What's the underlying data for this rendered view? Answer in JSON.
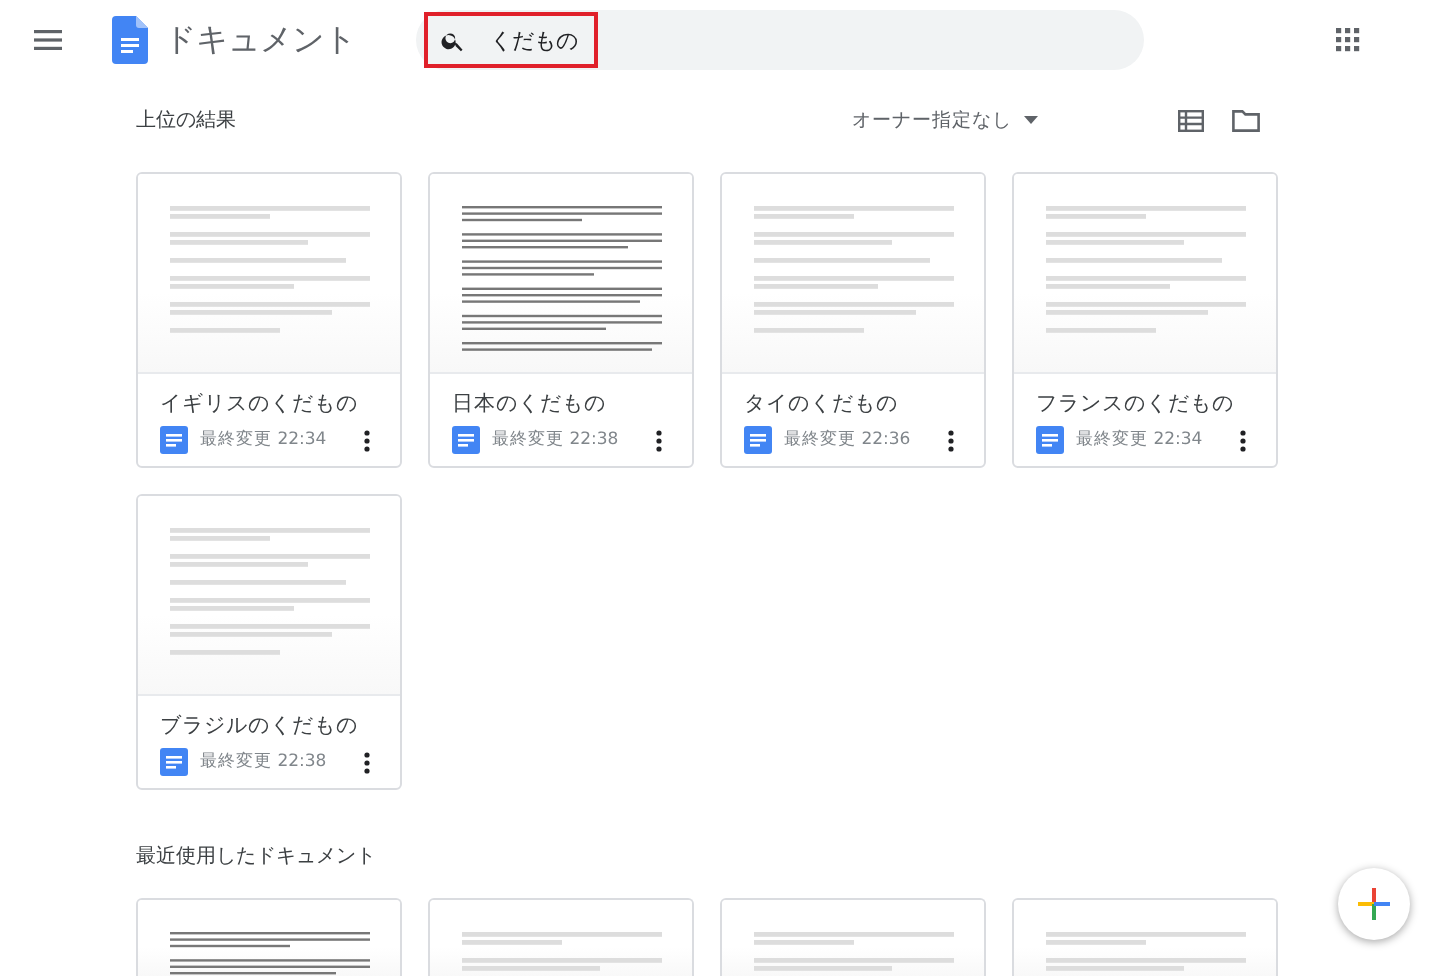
{
  "app": {
    "title": "ドキュメント"
  },
  "search": {
    "value": "くだもの",
    "highlighted": true
  },
  "top_results": {
    "heading": "上位の結果",
    "owner_filter": "オーナー指定なし",
    "documents": [
      {
        "title": "イギリスのくだもの",
        "modified": "最終変更 22:34",
        "dense_preview": false
      },
      {
        "title": "日本のくだもの",
        "modified": "最終変更 22:38",
        "dense_preview": true
      },
      {
        "title": "タイのくだもの",
        "modified": "最終変更 22:36",
        "dense_preview": false
      },
      {
        "title": "フランスのくだもの",
        "modified": "最終変更 22:34",
        "dense_preview": false
      },
      {
        "title": "ブラジルのくだもの",
        "modified": "最終変更 22:38",
        "dense_preview": false
      }
    ]
  },
  "recent": {
    "heading": "最近使用したドキュメント",
    "documents": [
      {
        "dense_preview": true
      },
      {
        "dense_preview": false
      },
      {
        "dense_preview": false
      },
      {
        "dense_preview": false
      }
    ]
  }
}
